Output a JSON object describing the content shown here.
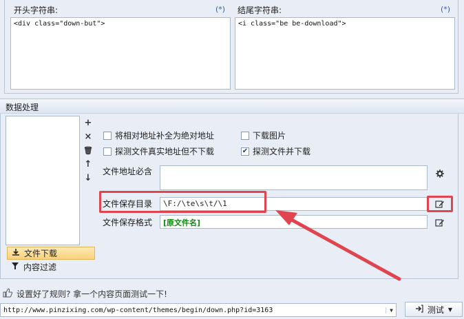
{
  "top": {
    "start_label": "开头字符串:",
    "start_star": "(*)",
    "start_value": "<div class=\"down-but\">",
    "end_label": "结尾字符串:",
    "end_star": "(*)",
    "end_value": "<i class=\"be be-download\">"
  },
  "section": {
    "title": "数据处理"
  },
  "side_buttons": {
    "add": "+",
    "delete": "×",
    "trash": "🗑",
    "up": "↑",
    "down": "↓"
  },
  "tabs": [
    {
      "label": "文件下载",
      "active": true,
      "icon": "download-icon"
    },
    {
      "label": "内容过滤",
      "active": false,
      "icon": "filter-icon"
    }
  ],
  "options": {
    "complete_url": {
      "label": "将相对地址补全为绝对地址",
      "checked": false
    },
    "download_images": {
      "label": "下载图片",
      "checked": false
    },
    "probe_real": {
      "label": "探测文件真实地址但不下载",
      "checked": false
    },
    "probe_download": {
      "label": "探测文件并下载",
      "checked": true
    }
  },
  "fields": {
    "url_must_label": "文件地址必含",
    "url_must_value": "",
    "save_dir_label": "文件保存目录",
    "save_dir_value": "\\F:/\\te\\s\\t/\\1",
    "save_format_label": "文件保存格式",
    "save_format_value": "[原文件名]"
  },
  "bottom": {
    "hint": "设置好了规则? 拿一个内容页面测试一下!",
    "url": "http://www.pinzixing.com/wp-content/themes/begin/down.php?id=3163",
    "test_label": "测试"
  },
  "colors": {
    "accent_red": "#e0454f",
    "tab_active": "#f9d279",
    "format_green": "#0a8a0a"
  }
}
